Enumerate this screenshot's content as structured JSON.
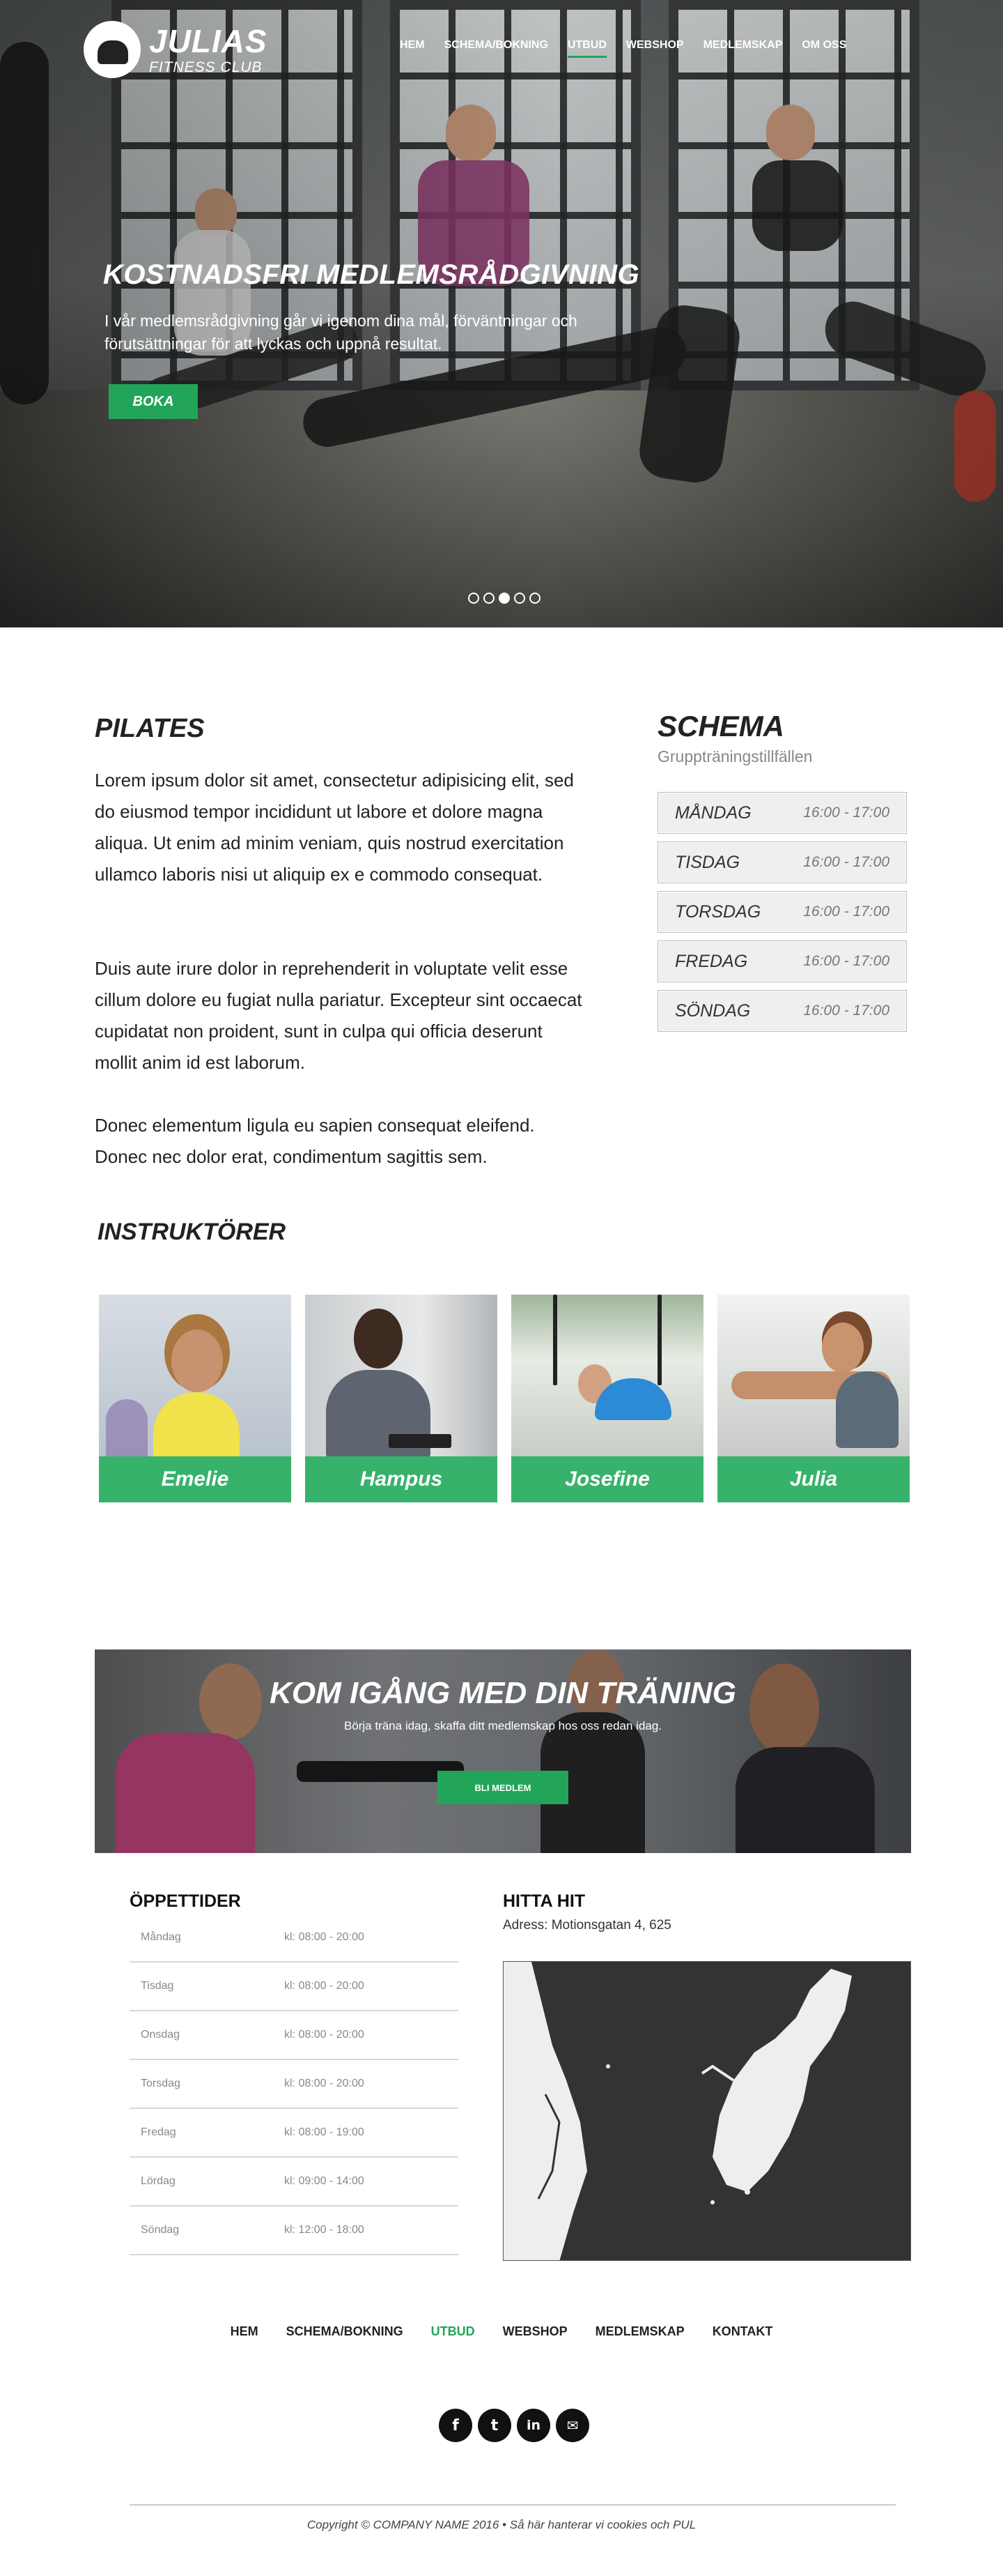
{
  "brand": {
    "name": "JULIAS",
    "tagline": "FITNESS CLUB"
  },
  "nav": [
    {
      "label": "HEM"
    },
    {
      "label": "SCHEMA/BOKNING"
    },
    {
      "label": "UTBUD",
      "active": true
    },
    {
      "label": "WEBSHOP"
    },
    {
      "label": "MEDLEMSKAP"
    },
    {
      "label": "OM OSS"
    }
  ],
  "hero": {
    "title": "KOSTNADSFRI MEDLEMSRÅDGIVNING",
    "text": " I vår medlemsrådgivning går vi igenom dina mål, förväntningar och förutsättningar för att lyckas och uppnå resultat.",
    "button": "BOKA",
    "slides": 5,
    "active_slide": 3
  },
  "pilates": {
    "title": "PILATES",
    "paragraphs": [
      "Lorem ipsum dolor sit amet, consectetur adipisicing elit, sed do eiusmod tempor incididunt ut labore et dolore magna aliqua. Ut enim ad minim veniam, quis nostrud exercitation ullamco laboris nisi ut aliquip ex e commodo consequat.",
      "Duis aute irure dolor in reprehenderit in voluptate velit esse cillum dolore eu fugiat nulla pariatur. Excepteur sint occaecat cupidatat non proident, sunt in culpa qui officia deserunt mollit anim id est laborum.",
      "Donec elementum ligula eu sapien consequat eleifend. Donec nec dolor erat, condimentum sagittis sem."
    ]
  },
  "schema": {
    "title": "SCHEMA",
    "subtitle": "Gruppträningstillfällen",
    "rows": [
      {
        "day": "MÅNDAG",
        "time": "16:00 - 17:00"
      },
      {
        "day": "TISDAG",
        "time": "16:00 - 17:00"
      },
      {
        "day": "TORSDAG",
        "time": "16:00 - 17:00"
      },
      {
        "day": "FREDAG",
        "time": "16:00 - 17:00"
      },
      {
        "day": "SÖNDAG",
        "time": "16:00 - 17:00"
      }
    ]
  },
  "instructors": {
    "title": "INSTRUKTÖRER",
    "items": [
      {
        "name": "Emelie"
      },
      {
        "name": "Hampus"
      },
      {
        "name": "Josefine"
      },
      {
        "name": "Julia"
      }
    ]
  },
  "cta": {
    "title": "KOM IGÅNG MED DIN TRÄNING",
    "text": "Börja träna idag, skaffa ditt medlemskap hos oss redan idag.",
    "button": "BLI MEDLEM"
  },
  "hours": {
    "title": "ÖPPETTIDER",
    "rows": [
      {
        "day": "Måndag",
        "time": "kl: 08:00 - 20:00"
      },
      {
        "day": "Tisdag",
        "time": "kl: 08:00 - 20:00"
      },
      {
        "day": "Onsdag",
        "time": "kl: 08:00 - 20:00"
      },
      {
        "day": "Torsdag",
        "time": "kl: 08:00 - 20:00"
      },
      {
        "day": "Fredag",
        "time": "kl: 08:00 - 19:00"
      },
      {
        "day": "Lördag",
        "time": "kl: 09:00 - 14:00"
      },
      {
        "day": "Söndag",
        "time": "kl: 12:00 - 18:00"
      }
    ]
  },
  "location": {
    "title": "HITTA HIT",
    "address": "Adress: Motionsgatan 4, 625"
  },
  "footer": {
    "nav": [
      {
        "label": "HEM"
      },
      {
        "label": "SCHEMA/BOKNING"
      },
      {
        "label": "UTBUD",
        "active": true
      },
      {
        "label": "WEBSHOP"
      },
      {
        "label": "MEDLEMSKAP"
      },
      {
        "label": "KONTAKT"
      }
    ],
    "socials": [
      {
        "icon": "facebook-icon",
        "glyph": "f"
      },
      {
        "icon": "twitter-icon",
        "glyph": "t"
      },
      {
        "icon": "linkedin-icon",
        "glyph": "in"
      },
      {
        "icon": "email-icon",
        "glyph": "✉"
      }
    ],
    "copyright": "Copyright © COMPANY NAME 2016 • Så här hanterar vi cookies och PUL"
  },
  "colors": {
    "accent": "#22a559",
    "card_label": "#37b26b",
    "map_bg": "#333333"
  }
}
